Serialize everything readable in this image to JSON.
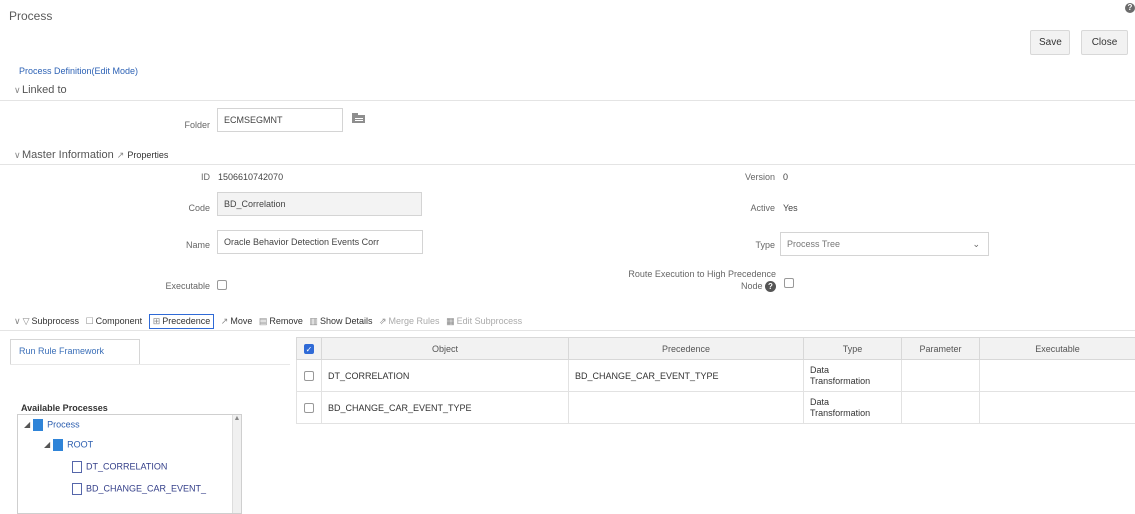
{
  "header": {
    "title": "Process",
    "help": "?"
  },
  "actions": {
    "save_label": "Save",
    "close_label": "Close"
  },
  "breadcrumb": "Process Definition(Edit Mode)",
  "linked_to": {
    "label": "Linked to",
    "folder_label": "Folder",
    "folder_value": "ECMSEGMNT",
    "folder_icon": "folder-picker-icon"
  },
  "master_info": {
    "label": "Master Information",
    "properties_label": "Properties",
    "id_label": "ID",
    "id_value": "1506610742070",
    "code_label": "Code",
    "code_value": "BD_Correlation",
    "name_label": "Name",
    "name_value": "Oracle Behavior Detection Events Corr",
    "executable_label": "Executable",
    "version_label": "Version",
    "version_value": "0",
    "active_label": "Active",
    "active_value": "Yes",
    "type_label": "Type",
    "type_value": "Process Tree",
    "route_label_line1": "Route Execution to High Precedence",
    "route_label_line2": "Node",
    "route_help": "?"
  },
  "toolbar": {
    "subprocess": "Subprocess",
    "component": "Component",
    "precedence": "Precedence",
    "move": "Move",
    "remove": "Remove",
    "show_details": "Show Details",
    "merge_rules": "Merge Rules",
    "edit_subprocess": "Edit Subprocess"
  },
  "left_panel": {
    "tab": "Run Rule Framework",
    "available_label": "Available Processes",
    "tree": {
      "process": "Process",
      "root": "ROOT",
      "leaf1": "DT_CORRELATION",
      "leaf2": "BD_CHANGE_CAR_EVENT_"
    }
  },
  "grid": {
    "columns": [
      "Object",
      "Precedence",
      "Type",
      "Parameter",
      "Executable"
    ],
    "rows": [
      {
        "object": "DT_CORRELATION",
        "precedence": "BD_CHANGE_CAR_EVENT_TYPE",
        "type_line1": "Data",
        "type_line2": "Transformation",
        "parameter": "",
        "executable": ""
      },
      {
        "object": "BD_CHANGE_CAR_EVENT_TYPE",
        "precedence": "",
        "type_line1": "Data",
        "type_line2": "Transformation",
        "parameter": "",
        "executable": ""
      }
    ]
  },
  "colors": {
    "link": "#2d62b5",
    "checkbox_accent": "#2f6ad6"
  }
}
